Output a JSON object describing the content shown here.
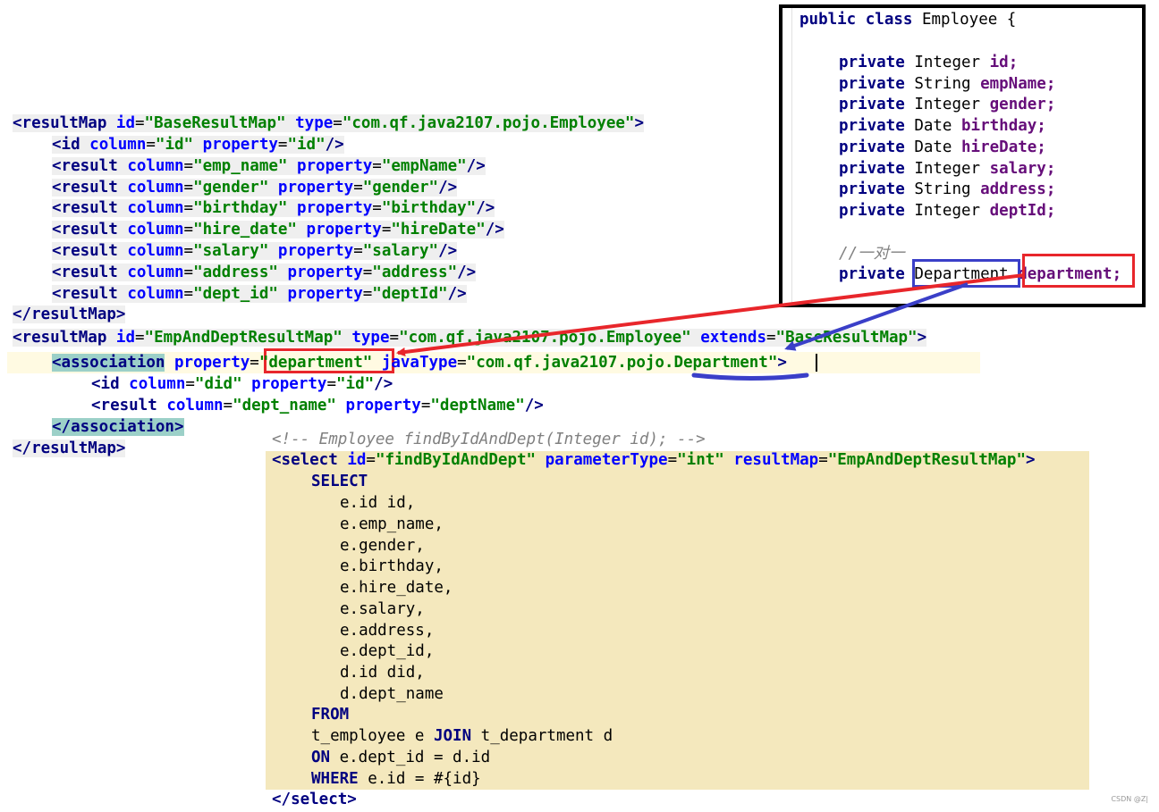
{
  "java_class": {
    "header": {
      "kw": "public class",
      "name": "Employee {"
    },
    "fields": [
      {
        "kw": "private",
        "type": "Integer",
        "name": "id;"
      },
      {
        "kw": "private",
        "type": "String",
        "name": "empName;"
      },
      {
        "kw": "private",
        "type": "Integer",
        "name": "gender;"
      },
      {
        "kw": "private",
        "type": "Date",
        "name": "birthday;"
      },
      {
        "kw": "private",
        "type": "Date",
        "name": "hireDate;"
      },
      {
        "kw": "private",
        "type": "Integer",
        "name": "salary;"
      },
      {
        "kw": "private",
        "type": "String",
        "name": "address;"
      },
      {
        "kw": "private",
        "type": "Integer",
        "name": "deptId;"
      }
    ],
    "comment": "//一对一",
    "relation": {
      "kw": "private",
      "type": "Department",
      "name": "department;"
    }
  },
  "base_result_map": {
    "open": {
      "lt": "<",
      "tag": "resultMap",
      "a1": "id",
      "v1": "\"BaseResultMap\"",
      "a2": "type",
      "v2": "\"com.qf.java2107.pojo.Employee\"",
      "gt": ">"
    },
    "id_line": {
      "tag": "<id",
      "a1": "column",
      "v1": "\"id\"",
      "a2": "property",
      "v2": "\"id\"",
      "end": "/>"
    },
    "results": [
      {
        "tag": "<result",
        "a1": "column",
        "v1": "\"emp_name\"",
        "a2": "property",
        "v2": "\"empName\"",
        "end": "/>"
      },
      {
        "tag": "<result",
        "a1": "column",
        "v1": "\"gender\"",
        "a2": "property",
        "v2": "\"gender\"",
        "end": "/>"
      },
      {
        "tag": "<result",
        "a1": "column",
        "v1": "\"birthday\"",
        "a2": "property",
        "v2": "\"birthday\"",
        "end": "/>"
      },
      {
        "tag": "<result",
        "a1": "column",
        "v1": "\"hire_date\"",
        "a2": "property",
        "v2": "\"hireDate\"",
        "end": "/>"
      },
      {
        "tag": "<result",
        "a1": "column",
        "v1": "\"salary\"",
        "a2": "property",
        "v2": "\"salary\"",
        "end": "/>"
      },
      {
        "tag": "<result",
        "a1": "column",
        "v1": "\"address\"",
        "a2": "property",
        "v2": "\"address\"",
        "end": "/>"
      },
      {
        "tag": "<result",
        "a1": "column",
        "v1": "\"dept_id\"",
        "a2": "property",
        "v2": "\"deptId\"",
        "end": "/>"
      }
    ],
    "close": "</resultMap>"
  },
  "emp_dept_result_map": {
    "open": {
      "lt": "<",
      "tag": "resultMap",
      "a1": "id",
      "v1": "\"EmpAndDeptResultMap\"",
      "a2": "type",
      "v2": "\"com.qf.java2107.pojo.Employee\"",
      "a3": "extends",
      "v3": "\"BaseResultMap\"",
      "gt": ">"
    },
    "association": {
      "lt": "<",
      "tag": "association",
      "a1": "property",
      "v1": "\"department\"",
      "a2": "javaType",
      "v2a": "\"com.qf.java2107.pojo.",
      "v2b": "Department\"",
      "gt": ">"
    },
    "id_line": {
      "tag": "<id",
      "a1": "column",
      "v1": "\"did\"",
      "a2": "property",
      "v2": "\"id\"",
      "end": "/>"
    },
    "result_line": {
      "tag": "<result",
      "a1": "column",
      "v1": "\"dept_name\"",
      "a2": "property",
      "v2": "\"deptName\"",
      "end": "/>"
    },
    "assoc_close": "</association>",
    "close": "</resultMap>"
  },
  "select_block": {
    "comment": "<!-- Employee findByIdAndDept(Integer id); -->",
    "open": {
      "tag": "<select",
      "a1": "id",
      "v1": "\"findByIdAndDept\"",
      "a2": "parameterType",
      "v2": "\"int\"",
      "a3": "resultMap",
      "v3": "\"EmpAndDeptResultMap\"",
      "gt": ">"
    },
    "select_kw": "SELECT",
    "columns": [
      "e.id id,",
      "e.emp_name,",
      "e.gender,",
      "e.birthday,",
      "e.hire_date,",
      "e.salary,",
      "e.address,",
      "e.dept_id,",
      "d.id did,",
      "d.dept_name"
    ],
    "from_kw": "FROM",
    "from_tables": {
      "t1": "t_employee e ",
      "join": "JOIN",
      "t2": " t_department d"
    },
    "on": {
      "kw": "ON",
      "expr": " e.dept_id = d.id"
    },
    "where": {
      "kw": "WHERE",
      "expr": " e.id = #{id}"
    },
    "close": "</select>"
  },
  "watermark": "CSDN @Z|",
  "colors": {
    "red_marker": "#e8262b",
    "blue_marker": "#3a3fc8",
    "sql_background": "#f4e8bd"
  }
}
